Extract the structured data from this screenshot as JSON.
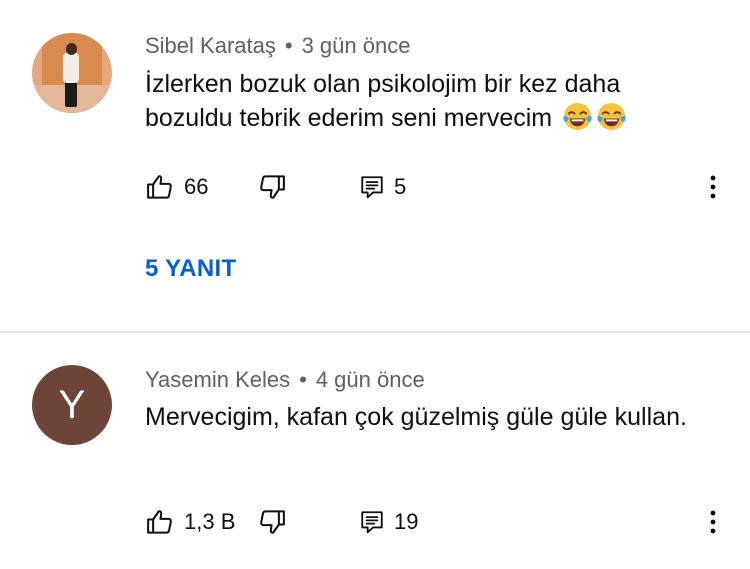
{
  "comments": [
    {
      "author": "Sibel Karataş",
      "separator": "•",
      "time": "3 gün önce",
      "text": "İzlerken bozuk olan psikolojim bir kez daha bozuldu tebrik ederim seni mervecim",
      "emoji": [
        "face-with-tears-of-joy",
        "face-with-tears-of-joy"
      ],
      "likes": "66",
      "replies_count": "5",
      "replies_button": "5 YANIT",
      "avatar": "photo"
    },
    {
      "author": "Yasemin Keles",
      "separator": "•",
      "time": "4 gün önce",
      "text": "Mervecigim, kafan çok güzelmiş güle güle kullan.",
      "likes": "1,3 B",
      "replies_count": "19",
      "avatar_letter": "Y",
      "avatar_color": "#6d4437"
    }
  ],
  "colors": {
    "meta": "#606060",
    "link": "#065fd4",
    "divider": "#e5e5e5"
  },
  "icons": [
    "thumbs-up-icon",
    "thumbs-down-icon",
    "reply-icon",
    "more-vertical-icon"
  ]
}
